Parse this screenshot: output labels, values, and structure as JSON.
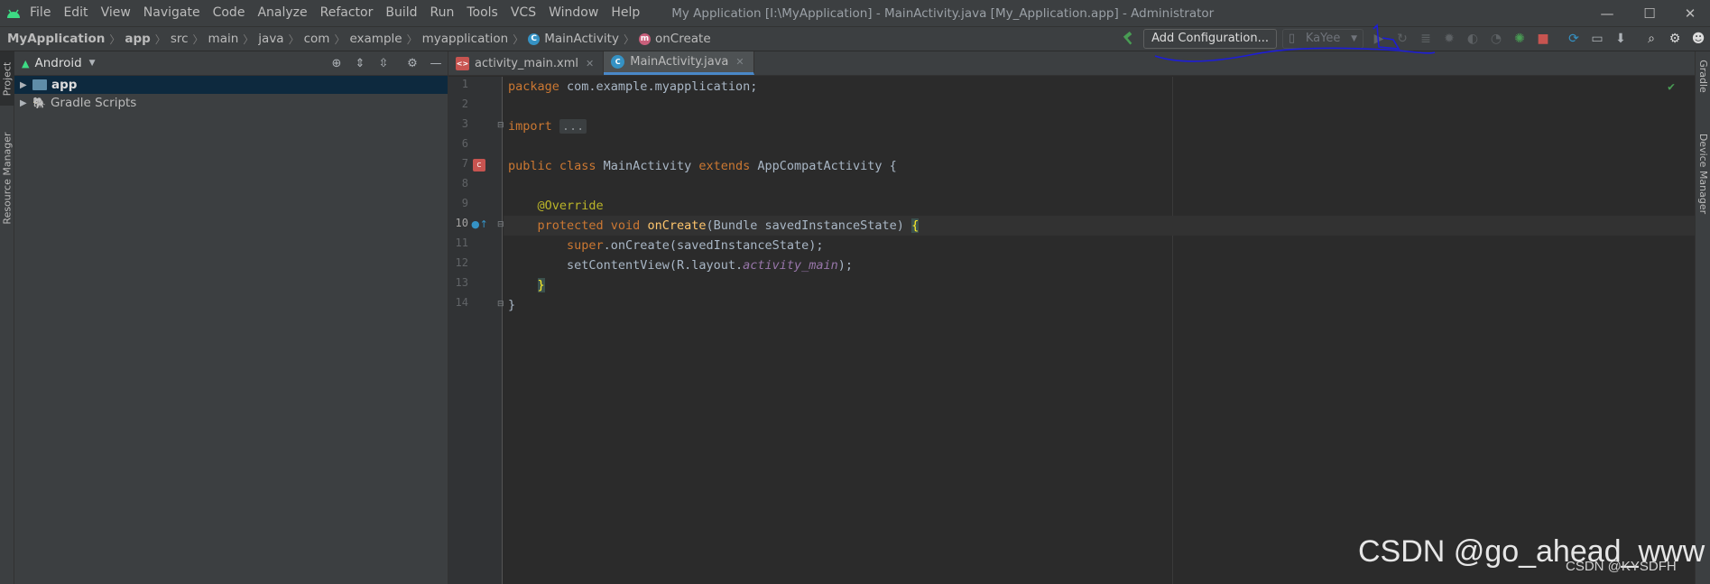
{
  "menubar": {
    "items": [
      "File",
      "Edit",
      "View",
      "Navigate",
      "Code",
      "Analyze",
      "Refactor",
      "Build",
      "Run",
      "Tools",
      "VCS",
      "Window",
      "Help"
    ],
    "window_title": "My Application [I:\\MyApplication] - MainActivity.java [My_Application.app] - Administrator",
    "window_controls": {
      "minimize": "—",
      "maximize": "☐",
      "close": "✕"
    }
  },
  "breadcrumb": [
    "MyApplication",
    "app",
    "src",
    "main",
    "java",
    "com",
    "example",
    "myapplication",
    "MainActivity",
    "onCreate"
  ],
  "toolbar": {
    "add_configuration": "Add Configuration...",
    "device": "KaYee"
  },
  "left_strip": {
    "project_tab": "Project",
    "resource_manager_tab": "Resource Manager"
  },
  "right_strip": {
    "gradle_tab": "Gradle",
    "device_manager_tab": "Device Manager"
  },
  "project": {
    "view_mode": "Android",
    "tree": [
      {
        "label": "app",
        "selected": true
      },
      {
        "label": "Gradle Scripts",
        "selected": false
      }
    ]
  },
  "editor": {
    "tabs": [
      {
        "label": "activity_main.xml",
        "active": false
      },
      {
        "label": "MainActivity.java",
        "active": true
      }
    ],
    "line_numbers": [
      "1",
      "2",
      "3",
      "6",
      "7",
      "8",
      "9",
      "10",
      "11",
      "12",
      "13",
      "14"
    ],
    "code": {
      "l1_kw": "package",
      "l1_rest": " com.example.myapplication;",
      "l3_kw": "import",
      "l3_fold": "...",
      "l7_kw": "public class",
      "l7_name": " MainActivity ",
      "l7_kw2": "extends",
      "l7_rest": " AppCompatActivity {",
      "l9_ann": "@Override",
      "l10_kw": "protected void",
      "l10_fn": "onCreate",
      "l10_rest": "(Bundle savedInstanceState) ",
      "l10_brace": "{",
      "l11_kw": "super",
      "l11_rest": ".onCreate(savedInstanceState);",
      "l12_a": "setContentView(R.layout.",
      "l12_it": "activity_main",
      "l12_b": ");",
      "l13_brace": "}",
      "l14": "}"
    }
  },
  "watermark": {
    "main": "CSDN @go_ahead_www",
    "sub": "CSDN @KYSDFH"
  },
  "colors": {
    "accent": "#4a88c7",
    "run_green": "#499c54",
    "stop_red": "#c75450",
    "annotation_blue": "#1d1dd8"
  }
}
